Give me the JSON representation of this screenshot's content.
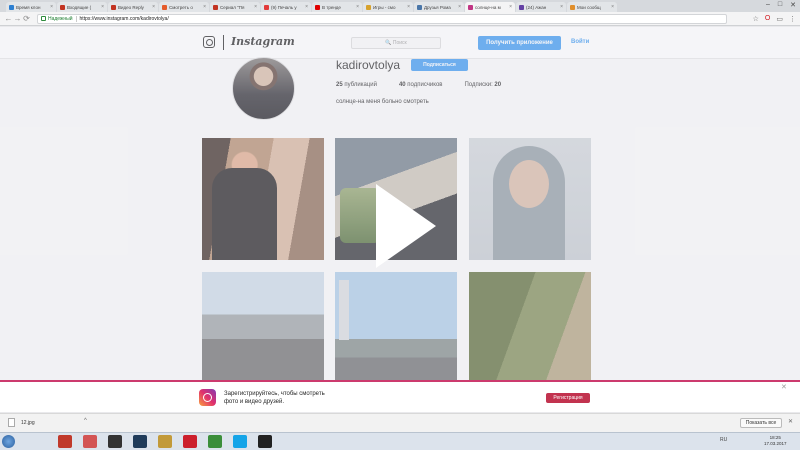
{
  "browser": {
    "tabs": [
      {
        "label": "Время клон",
        "fav": "#2d7fd1"
      },
      {
        "label": "Входящие (",
        "fav": "#c23321"
      },
      {
        "label": "Видео Reply",
        "fav": "#c23321"
      },
      {
        "label": "Смотреть о",
        "fav": "#e55b2a"
      },
      {
        "label": "Сериал \"Пя",
        "fav": "#c23321"
      },
      {
        "label": "(9) Печаль у",
        "fav": "#e23a3a"
      },
      {
        "label": "В тренде",
        "fav": "#e00000"
      },
      {
        "label": "Игры - смо",
        "fav": "#d7a22d"
      },
      {
        "label": "Друзья Рома",
        "fav": "#4a76a8"
      },
      {
        "label": "солнце-на м",
        "fav": "#c13584",
        "active": true
      },
      {
        "label": "(24) Ажан",
        "fav": "#6441a4"
      },
      {
        "label": "Мои сообщ",
        "fav": "#e08e2b"
      }
    ],
    "secure_label": "Надежный",
    "url": "https://www.instagram.com/kadirovtolya/",
    "window_controls": {
      "minimize": "–",
      "maximize": "□",
      "close": "✕"
    }
  },
  "instagram": {
    "logo_text": "Instagram",
    "search_placeholder": "🔍 Поиск",
    "get_app_label": "Получить приложение",
    "login_label": "Войти",
    "username": "kadirovtolya",
    "follow_label": "Подписаться",
    "stats": {
      "posts_count": "25",
      "posts_label": " публикаций",
      "followers_count": "40",
      "followers_label": " подписчиков",
      "following_label": "Подписки: ",
      "following_count": "20"
    },
    "bio": "солнце-на меня больно смотреть"
  },
  "banner": {
    "text": "Зарегистрируйтесь, чтобы смотреть фото и видео друзей.",
    "button_label": "Регистрация",
    "close": "✕"
  },
  "downloads": {
    "file_name": "12.jpg",
    "show_all_label": "Показать все",
    "close": "✕"
  },
  "taskbar": {
    "items": [
      {
        "name": "download-app-icon",
        "color": "#c0392b"
      },
      {
        "name": "chrome-red-icon",
        "color": "#d35454"
      },
      {
        "name": "media-app-icon",
        "color": "#333333"
      },
      {
        "name": "photoshop-icon",
        "color": "#1f3b5a"
      },
      {
        "name": "explorer-icon",
        "color": "#c29a3a"
      },
      {
        "name": "opera-icon",
        "color": "#cc1f2d"
      },
      {
        "name": "chrome-icon",
        "color": "#3b8e3b"
      },
      {
        "name": "skype-icon",
        "color": "#14a4e8"
      },
      {
        "name": "player-icon",
        "color": "#222222"
      }
    ],
    "language": "RU",
    "time": "18:25",
    "date": "17.03.2017"
  }
}
